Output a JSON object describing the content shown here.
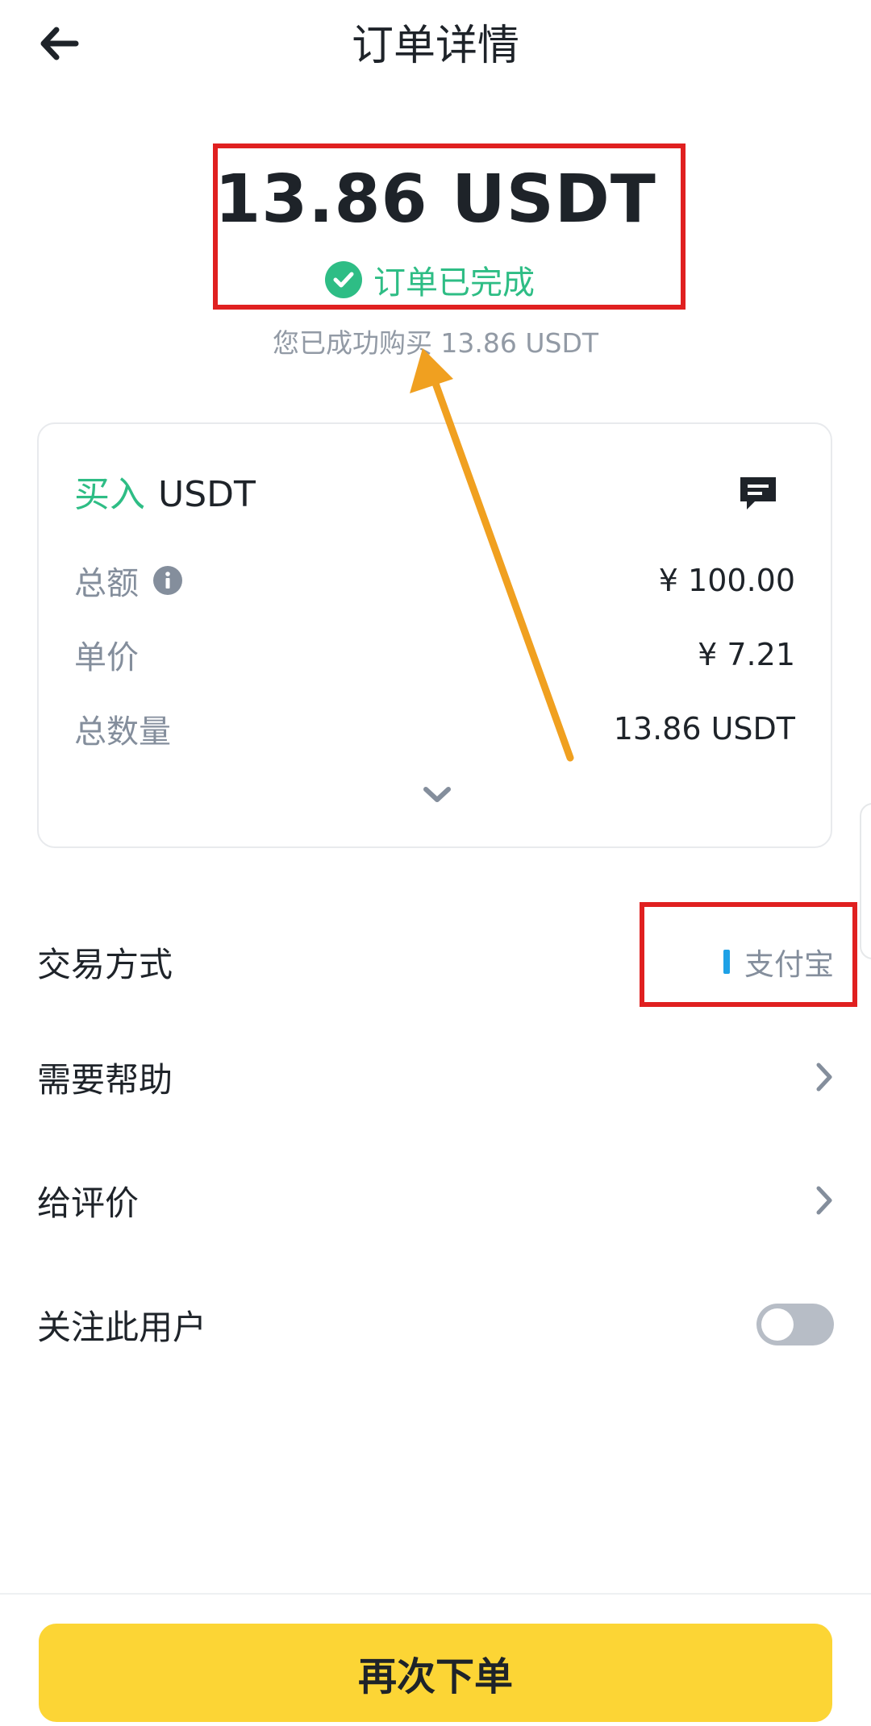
{
  "header": {
    "title": "订单详情",
    "back_icon": "arrow-left-icon"
  },
  "summary": {
    "amount": "13.86 USDT",
    "status": "订单已完成",
    "status_color": "#2ebd85",
    "success_message": "您已成功购买  13.86 USDT"
  },
  "order_card": {
    "side": "买入",
    "asset": "USDT",
    "rows": [
      {
        "label": "总额",
        "value": "¥ 100.00"
      },
      {
        "label": "单价",
        "value": "¥ 7.21"
      },
      {
        "label": "总数量",
        "value": "13.86 USDT"
      }
    ]
  },
  "details": {
    "payment_label": "交易方式",
    "payment_value": "支付宝",
    "payment_color": "#1ea1e6",
    "help_label": "需要帮助",
    "review_label": "给评价",
    "follow_label": "关注此用户",
    "follow_on": false
  },
  "footer": {
    "reorder_label": "再次下单",
    "button_color": "#fcd535"
  },
  "annotations": {
    "box_color": "#e02020",
    "arrow_color": "#f0a020"
  }
}
